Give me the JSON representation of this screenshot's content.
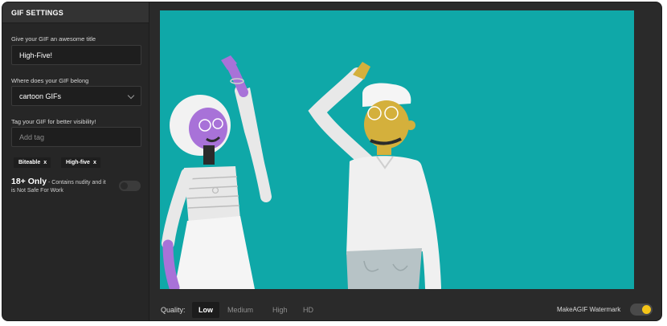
{
  "sidebar": {
    "header": "GIF SETTINGS",
    "title_label": "Give your GIF an awesome title",
    "title_value": "High-Five!",
    "category_label": "Where does your GIF belong",
    "category_value": "cartoon GIFs",
    "tag_label": "Tag your GIF for better visibility!",
    "tag_placeholder": "Add tag",
    "tags": [
      {
        "label": "Biteable",
        "remove": "x"
      },
      {
        "label": "High-five",
        "remove": "x"
      }
    ],
    "adult_title": "18+ Only",
    "adult_desc": " - Contains nudity and it is Not Safe For Work",
    "adult_enabled": false
  },
  "preview": {
    "background": "#0fa8a8",
    "illustration": "two cartoon people giving a high-five"
  },
  "bottom": {
    "quality_label": "Quality:",
    "options": [
      "Low",
      "Medium",
      "High",
      "HD"
    ],
    "selected": "Low",
    "watermark_label": "MakeAGIF Watermark",
    "watermark_enabled": true,
    "accent": "#f5c518"
  }
}
